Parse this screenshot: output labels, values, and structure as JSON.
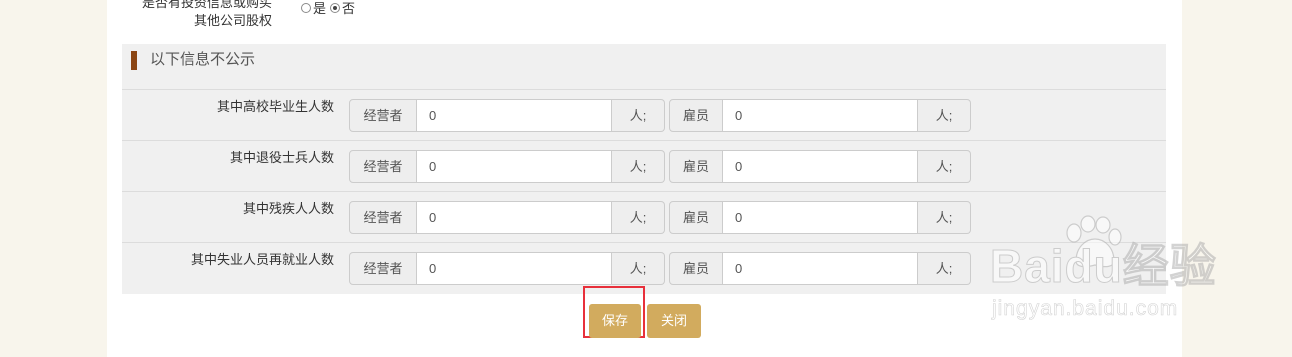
{
  "investment_row": {
    "label_line1": "是否有投资信息或购买",
    "label_line2": "其他公司股权",
    "options": [
      {
        "label": "是",
        "checked": false
      },
      {
        "label": "否",
        "checked": true
      }
    ]
  },
  "section": {
    "title": "以下信息不公示",
    "rows": [
      {
        "label": "其中高校毕业生人数",
        "operator_label": "经营者",
        "operator_value": "0",
        "operator_unit": "人;",
        "employee_label": "雇员",
        "employee_value": "0",
        "employee_unit": "人;"
      },
      {
        "label": "其中退役士兵人数",
        "operator_label": "经营者",
        "operator_value": "0",
        "operator_unit": "人;",
        "employee_label": "雇员",
        "employee_value": "0",
        "employee_unit": "人;"
      },
      {
        "label": "其中残疾人人数",
        "operator_label": "经营者",
        "operator_value": "0",
        "operator_unit": "人;",
        "employee_label": "雇员",
        "employee_value": "0",
        "employee_unit": "人;"
      },
      {
        "label": "其中失业人员再就业人数",
        "operator_label": "经营者",
        "operator_value": "0",
        "operator_unit": "人;",
        "employee_label": "雇员",
        "employee_value": "0",
        "employee_unit": "人;"
      }
    ]
  },
  "buttons": {
    "save_label": "保存",
    "close_label": "关闭"
  },
  "watermark": {
    "main": "Baidu经验",
    "sub": "jingyan.baidu.com"
  },
  "colors": {
    "button": "#d2ab5e",
    "section_marker": "#8b4513",
    "highlight_box": "#e8303b",
    "page_background": "#f8f5ec"
  }
}
